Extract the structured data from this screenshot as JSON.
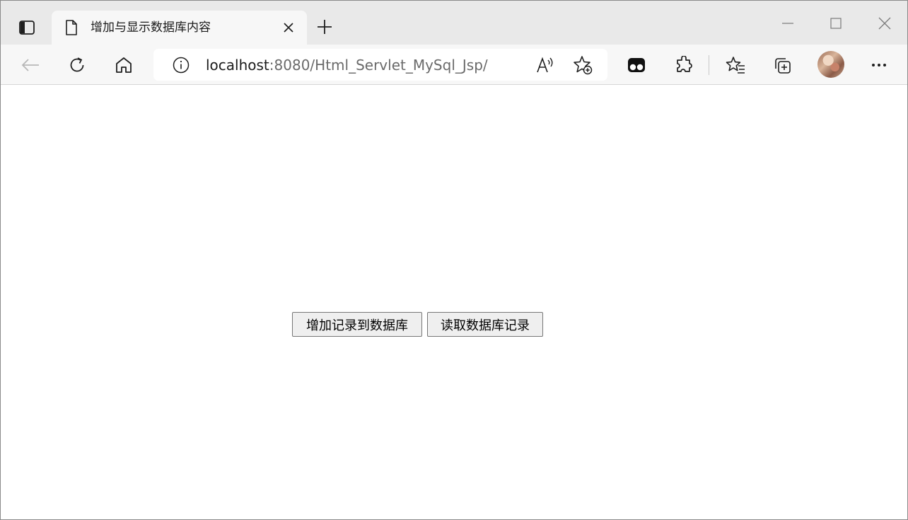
{
  "window": {
    "colors": {
      "tabstrip": "#e9e9e9",
      "toolbar": "#f7f7f7",
      "page": "#ffffff"
    }
  },
  "tabs": [
    {
      "title": "增加与显示数据库内容",
      "active": true,
      "icon": "page-icon"
    }
  ],
  "address_bar": {
    "host": "localhost",
    "path": ":8080/Html_Servlet_MySql_Jsp/"
  },
  "toolbar": {
    "icons": [
      "back-icon",
      "refresh-icon",
      "home-icon",
      "info-icon",
      "read-aloud-icon",
      "add-favorite-icon",
      "tracker-icon",
      "extensions-icon",
      "favorites-icon",
      "collections-icon",
      "avatar",
      "more-icon"
    ]
  },
  "page": {
    "buttons": {
      "add_label": "增加记录到数据库",
      "read_label": "读取数据库记录"
    }
  }
}
